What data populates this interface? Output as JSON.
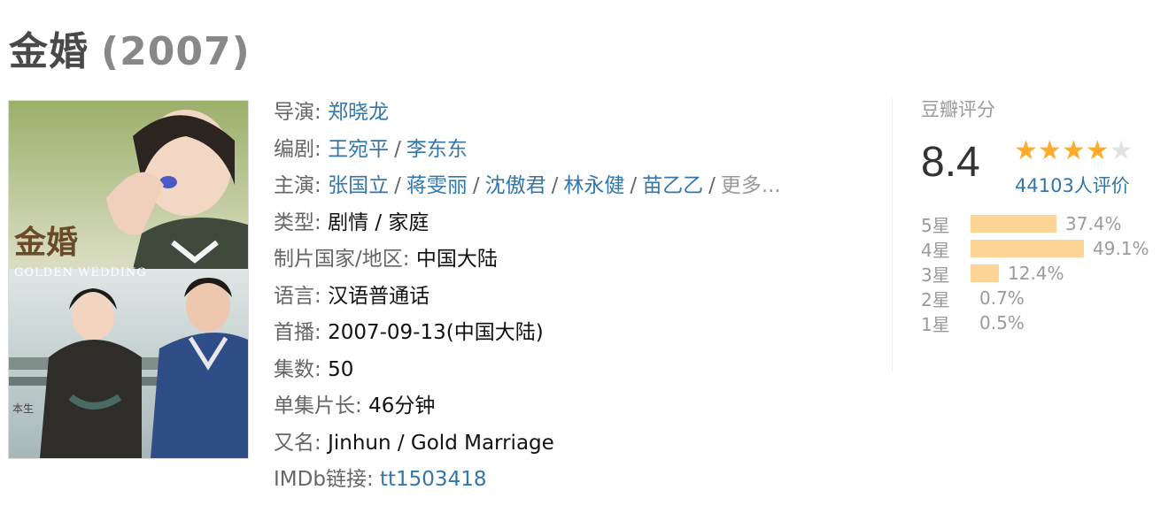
{
  "title": {
    "name": "金婚",
    "year": "(2007)"
  },
  "poster": {
    "title_text": "金婚",
    "subtitle_text": "GOLDEN WEDDING",
    "badge_text": "本生"
  },
  "info": {
    "director": {
      "label": "导演",
      "values": [
        "郑晓龙"
      ]
    },
    "writer": {
      "label": "编剧",
      "values": [
        "王宛平",
        "李东东"
      ]
    },
    "cast": {
      "label": "主演",
      "values": [
        "张国立",
        "蒋雯丽",
        "沈傲君",
        "林永健",
        "苗乙乙"
      ],
      "more": "更多..."
    },
    "genre": {
      "label": "类型",
      "value": "剧情 / 家庭"
    },
    "country": {
      "label": "制片国家/地区",
      "value": "中国大陆"
    },
    "language": {
      "label": "语言",
      "value": "汉语普通话"
    },
    "premiere": {
      "label": "首播",
      "value": "2007-09-13(中国大陆)"
    },
    "episodes": {
      "label": "集数",
      "value": "50"
    },
    "episode_length": {
      "label": "单集片长",
      "value": "46分钟"
    },
    "aka": {
      "label": "又名",
      "value": "Jinhun / Gold Marriage"
    },
    "imdb": {
      "label": "IMDb链接",
      "value": "tt1503418"
    }
  },
  "rating": {
    "title": "豆瓣评分",
    "score": "8.4",
    "stars_filled": 4,
    "stars_total": 5,
    "votes": "44103人评价",
    "distribution": [
      {
        "label": "5星",
        "percent": "37.4%",
        "value": 37.4
      },
      {
        "label": "4星",
        "percent": "49.1%",
        "value": 49.1
      },
      {
        "label": "3星",
        "percent": "12.4%",
        "value": 12.4
      },
      {
        "label": "2星",
        "percent": "0.7%",
        "value": 0.7
      },
      {
        "label": "1星",
        "percent": "0.5%",
        "value": 0.5
      }
    ]
  },
  "colors": {
    "link": "#3377aa",
    "star": "#ffac2d",
    "bar": "#ffd596",
    "label": "#666666"
  }
}
